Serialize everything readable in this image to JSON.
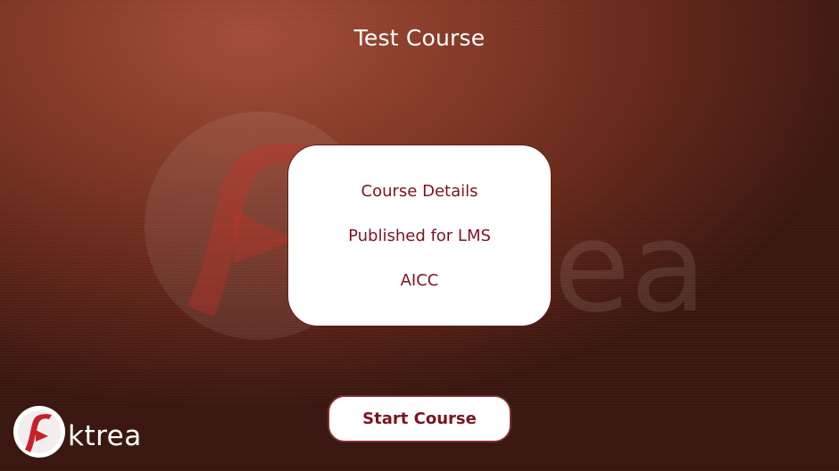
{
  "course": {
    "title": "Test Course"
  },
  "details_card": {
    "line1": "Course Details",
    "line2": "Published for LMS",
    "line3": "AICC"
  },
  "start_button": {
    "label": "Start Course"
  },
  "brand": {
    "logo_text": "ktrea",
    "watermark_text": "ea",
    "icon": "aktrea-logo-icon",
    "colors": {
      "primary": "#b2212c",
      "text_dark": "#7a1420",
      "background_top": "#a44f3a",
      "background_bottom": "#3a1710"
    }
  }
}
